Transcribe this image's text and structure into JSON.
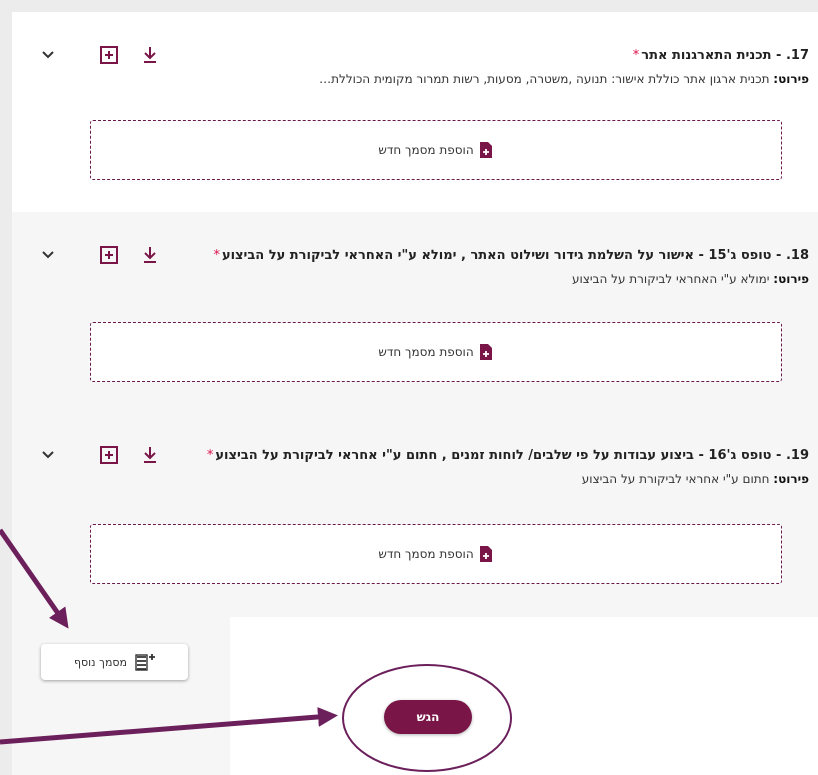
{
  "sections": [
    {
      "title": "17. - תכנית התארגנות אתר",
      "required_mark": "*",
      "desc_label": "פירוט:",
      "desc_text": "תכנית ארגון אתר כוללת אישור: תנועה ,משטרה, מסעות, רשות תמרור מקומית הכוללת…",
      "dropzone_label": "הוספת מסמך חדש"
    },
    {
      "title": "18. - טופס ג'15 - אישור על השלמת גידור ושילוט האתר , ימולא ע\"י האחראי לביקורת על הביצוע",
      "required_mark": "*",
      "desc_label": "פירוט:",
      "desc_text": "ימולא ע\"י האחראי לביקורת על הביצוע",
      "dropzone_label": "הוספת מסמך חדש"
    },
    {
      "title": "19. - טופס ג'16 - ביצוע עבודות על פי שלבים/ לוחות זמנים , חתום ע\"י אחראי לביקורת על הביצוע",
      "required_mark": "*",
      "desc_label": "פירוט:",
      "desc_text": "חתום ע\"י אחראי לביקורת על הביצוע",
      "dropzone_label": "הוספת מסמך חדש"
    }
  ],
  "actions": {
    "add_document_label": "מסמך נוסף",
    "submit_label": "הגש"
  },
  "colors": {
    "brand": "#7a1548",
    "required": "#d9124b",
    "annotation": "#6b1f5b"
  },
  "icons": {
    "collapse": "chevron-down-icon",
    "add": "add-box-icon",
    "download": "download-icon",
    "document": "document-add-icon",
    "note": "note-add-icon"
  }
}
